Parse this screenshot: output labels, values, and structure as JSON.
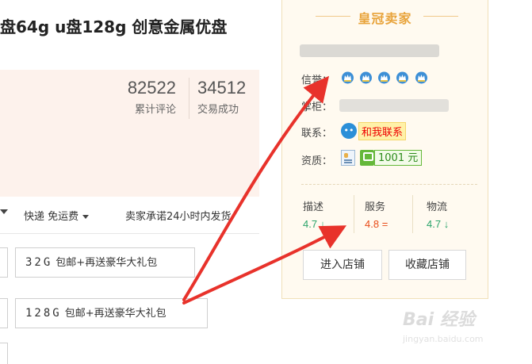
{
  "product": {
    "title": "盘64g u盘128g 创意金属优盘",
    "stats": [
      {
        "value": "82522",
        "label": "累计评论"
      },
      {
        "value": "34512",
        "label": "交易成功"
      }
    ],
    "shipping": "快递 免运费",
    "promise": "卖家承诺24小时内发货",
    "options": [
      {
        "capacity": "32G",
        "desc": "包邮+再送豪华大礼包"
      },
      {
        "capacity": "128G",
        "desc": "包邮+再送豪华大礼包"
      }
    ]
  },
  "seller": {
    "title": "皇冠卖家",
    "credit_label": "信誉：",
    "shop_label": "掌柜：",
    "contact_label": "联系：",
    "contact_button": "和我联系",
    "qualification_label": "资质：",
    "deposit": "1001 元",
    "crown_count": 5,
    "scores": [
      {
        "label": "描述",
        "value": "4.7",
        "trend": "down",
        "trend_symbol": "↓"
      },
      {
        "label": "服务",
        "value": "4.8",
        "trend": "equal",
        "trend_symbol": "="
      },
      {
        "label": "物流",
        "value": "4.7",
        "trend": "down",
        "trend_symbol": "↓"
      }
    ],
    "buttons": {
      "enter": "进入店铺",
      "favorite": "收藏店铺"
    }
  },
  "watermark": {
    "logo": "Bai 经验",
    "url": "jingyan.baidu.com"
  },
  "colors": {
    "accent": "#e8a33a",
    "score_green": "#2aa36a",
    "score_red": "#e84a16",
    "arrow": "#e8322b",
    "panel": "#fdf2ec"
  }
}
